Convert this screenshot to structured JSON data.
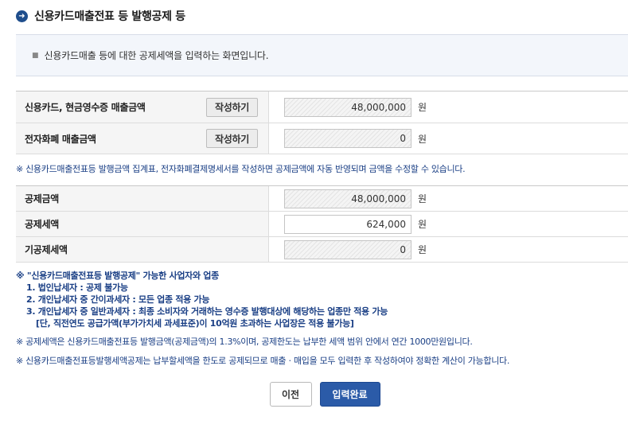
{
  "header": {
    "icon": "arrow-right-circle-icon",
    "title": "신용카드매출전표 등 발행공제 등"
  },
  "info": {
    "text": "신용카드매출 등에 대한 공제세액을 입력하는 화면입니다."
  },
  "sales_rows": [
    {
      "label": "신용카드, 현금영수증 매출금액",
      "button": "작성하기",
      "value": "48,000,000",
      "unit": "원"
    },
    {
      "label": "전자화폐 매출금액",
      "button": "작성하기",
      "value": "0",
      "unit": "원"
    }
  ],
  "note1": "※ 신용카드매출전표등 발행금액 집계표, 전자화폐결제명세서를 작성하면 공제금액에 자동 반영되며 금액을 수정할 수 있습니다.",
  "deduction_rows": [
    {
      "label": "공제금액",
      "value": "48,000,000",
      "unit": "원"
    },
    {
      "label": "공제세액",
      "value": "624,000",
      "unit": "원"
    },
    {
      "label": "기공제세액",
      "value": "0",
      "unit": "원"
    }
  ],
  "note2": {
    "title": "※ \"신용카드매출전표등 발행공제\" 가능한 사업자와 업종",
    "items": [
      "1. 법인납세자 : 공제 불가능",
      "2. 개인납세자 중 간이과세자 : 모든 업종 적용 가능",
      "3. 개인납세자 중 일반과세자 : 최종 소비자와 거래하는 영수증 발행대상에 해당하는 업종만 적용 가능",
      "[단, 직전연도 공급가액(부가가치세 과세표준)이 10억원 초과하는 사업장은 적용 불가능]"
    ]
  },
  "note3": "※ 공제세액은 신용카드매출전표등 발행금액(공제금액)의 1.3%이며, 공제한도는 납부한 세액 범위 안에서 연간 1000만원입니다.",
  "note4": "※ 신용카드매출전표등발행세액공제는 납부할세액을 한도로 공제되므로 매출ㆍ매입을 모두 입력한 후 작성하여야 정확한 계산이 가능합니다.",
  "buttons": {
    "prev": "이전",
    "done": "입력완료"
  },
  "colors": {
    "accent": "#2b5ba8",
    "note_blue": "#1a3f85",
    "title_icon": "#1f4e8c"
  }
}
